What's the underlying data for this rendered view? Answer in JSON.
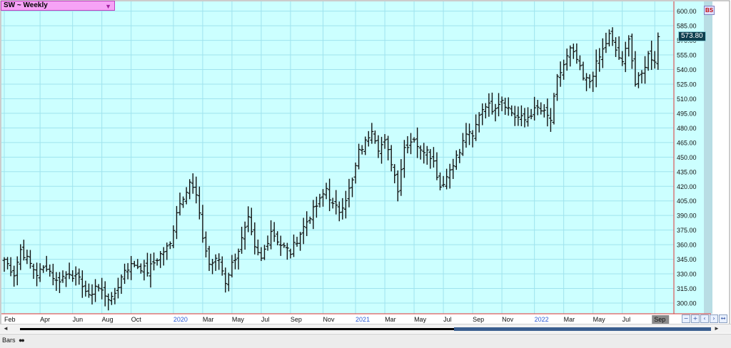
{
  "title_box": {
    "label": "SW ~ Weekly",
    "dropdown_icon": "triangle-down-icon"
  },
  "last_price": "573.80",
  "badge": "BS",
  "bottom": {
    "mode_label": "Bars",
    "mode_icon": "binoculars-icon"
  },
  "toolbar_icons": [
    "zoom-out-icon",
    "zoom-in-icon",
    "scroll-left-icon",
    "scroll-right-icon",
    "expand-icon",
    "contract-icon"
  ],
  "colors": {
    "background": "#ccffff",
    "grid": "#9fe3ee",
    "bars": "#111111",
    "axis_line": "#dd3333",
    "year_label": "#2b5bd7"
  },
  "chart_data": {
    "type": "bar",
    "subtype": "ohlc",
    "title": "SW ~ Weekly",
    "ylim": [
      289,
      610
    ],
    "yticks": [
      "600.00",
      "585.00",
      "570.00",
      "555.00",
      "540.00",
      "525.00",
      "510.00",
      "495.00",
      "480.00",
      "465.00",
      "450.00",
      "435.00",
      "420.00",
      "405.00",
      "390.00",
      "375.00",
      "360.00",
      "345.00",
      "330.00",
      "315.00",
      "300.00"
    ],
    "x_labels": [
      {
        "text": "Feb",
        "week": 0,
        "year": false
      },
      {
        "text": "Apr",
        "week": 11,
        "year": false
      },
      {
        "text": "Jun",
        "week": 21,
        "year": false
      },
      {
        "text": "Aug",
        "week": 30,
        "year": false
      },
      {
        "text": "Oct",
        "week": 39,
        "year": false
      },
      {
        "text": "2020",
        "week": 52,
        "year": true
      },
      {
        "text": "Mar",
        "week": 61,
        "year": false
      },
      {
        "text": "May",
        "week": 70,
        "year": false
      },
      {
        "text": "Jul",
        "week": 79,
        "year": false
      },
      {
        "text": "Sep",
        "week": 88,
        "year": false
      },
      {
        "text": "Nov",
        "week": 98,
        "year": false
      },
      {
        "text": "2021",
        "week": 108,
        "year": true
      },
      {
        "text": "Mar",
        "week": 117,
        "year": false
      },
      {
        "text": "May",
        "week": 126,
        "year": false
      },
      {
        "text": "Jul",
        "week": 135,
        "year": false
      },
      {
        "text": "Sep",
        "week": 144,
        "year": false
      },
      {
        "text": "Nov",
        "week": 153,
        "year": false
      },
      {
        "text": "2022",
        "week": 163,
        "year": true
      },
      {
        "text": "Mar",
        "week": 172,
        "year": false
      },
      {
        "text": "May",
        "week": 181,
        "year": false
      },
      {
        "text": "Jul",
        "week": 190,
        "year": false
      },
      {
        "text": "Sep",
        "week": 200,
        "year": false
      }
    ],
    "series": [
      {
        "ohlc_close_anchors": [
          {
            "w": 0,
            "c": 345
          },
          {
            "w": 3,
            "c": 330
          },
          {
            "w": 5,
            "c": 355
          },
          {
            "w": 8,
            "c": 340
          },
          {
            "w": 10,
            "c": 330
          },
          {
            "w": 13,
            "c": 338
          },
          {
            "w": 16,
            "c": 322
          },
          {
            "w": 20,
            "c": 332
          },
          {
            "w": 24,
            "c": 320
          },
          {
            "w": 26,
            "c": 305
          },
          {
            "w": 28,
            "c": 318
          },
          {
            "w": 30,
            "c": 312
          },
          {
            "w": 33,
            "c": 303
          },
          {
            "w": 35,
            "c": 318
          },
          {
            "w": 37,
            "c": 335
          },
          {
            "w": 40,
            "c": 340
          },
          {
            "w": 44,
            "c": 333
          },
          {
            "w": 48,
            "c": 350
          },
          {
            "w": 51,
            "c": 360
          },
          {
            "w": 53,
            "c": 395
          },
          {
            "w": 55,
            "c": 410
          },
          {
            "w": 57,
            "c": 425
          },
          {
            "w": 59,
            "c": 410
          },
          {
            "w": 61,
            "c": 368
          },
          {
            "w": 63,
            "c": 340
          },
          {
            "w": 66,
            "c": 345
          },
          {
            "w": 68,
            "c": 322
          },
          {
            "w": 70,
            "c": 340
          },
          {
            "w": 72,
            "c": 355
          },
          {
            "w": 75,
            "c": 385
          },
          {
            "w": 77,
            "c": 355
          },
          {
            "w": 79,
            "c": 345
          },
          {
            "w": 82,
            "c": 375
          },
          {
            "w": 85,
            "c": 360
          },
          {
            "w": 88,
            "c": 352
          },
          {
            "w": 91,
            "c": 372
          },
          {
            "w": 94,
            "c": 390
          },
          {
            "w": 97,
            "c": 405
          },
          {
            "w": 99,
            "c": 418
          },
          {
            "w": 101,
            "c": 400
          },
          {
            "w": 103,
            "c": 395
          },
          {
            "w": 105,
            "c": 408
          },
          {
            "w": 107,
            "c": 425
          },
          {
            "w": 109,
            "c": 455
          },
          {
            "w": 111,
            "c": 465
          },
          {
            "w": 113,
            "c": 480
          },
          {
            "w": 115,
            "c": 460
          },
          {
            "w": 117,
            "c": 465
          },
          {
            "w": 119,
            "c": 445
          },
          {
            "w": 121,
            "c": 418
          },
          {
            "w": 123,
            "c": 460
          },
          {
            "w": 126,
            "c": 470
          },
          {
            "w": 128,
            "c": 455
          },
          {
            "w": 130,
            "c": 460
          },
          {
            "w": 132,
            "c": 445
          },
          {
            "w": 134,
            "c": 420
          },
          {
            "w": 136,
            "c": 430
          },
          {
            "w": 138,
            "c": 445
          },
          {
            "w": 140,
            "c": 455
          },
          {
            "w": 142,
            "c": 475
          },
          {
            "w": 144,
            "c": 470
          },
          {
            "w": 146,
            "c": 495
          },
          {
            "w": 148,
            "c": 505
          },
          {
            "w": 150,
            "c": 500
          },
          {
            "w": 153,
            "c": 510
          },
          {
            "w": 155,
            "c": 500
          },
          {
            "w": 157,
            "c": 492
          },
          {
            "w": 160,
            "c": 488
          },
          {
            "w": 162,
            "c": 495
          },
          {
            "w": 164,
            "c": 500
          },
          {
            "w": 166,
            "c": 495
          },
          {
            "w": 168,
            "c": 488
          },
          {
            "w": 170,
            "c": 530
          },
          {
            "w": 172,
            "c": 545
          },
          {
            "w": 174,
            "c": 560
          },
          {
            "w": 176,
            "c": 550
          },
          {
            "w": 178,
            "c": 530
          },
          {
            "w": 180,
            "c": 528
          },
          {
            "w": 182,
            "c": 545
          },
          {
            "w": 184,
            "c": 560
          },
          {
            "w": 186,
            "c": 575
          },
          {
            "w": 188,
            "c": 560
          },
          {
            "w": 190,
            "c": 545
          },
          {
            "w": 192,
            "c": 575
          },
          {
            "w": 194,
            "c": 525
          },
          {
            "w": 196,
            "c": 535
          },
          {
            "w": 198,
            "c": 555
          },
          {
            "w": 200,
            "c": 550
          },
          {
            "w": 201,
            "c": 573.8
          }
        ]
      }
    ],
    "last_value": 573.8
  }
}
